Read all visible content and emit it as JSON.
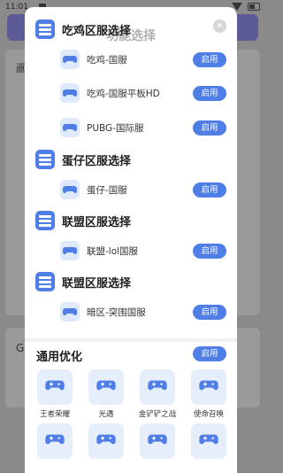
{
  "status_bar": {
    "time": "11:01"
  },
  "background": {
    "card1_peek": "画",
    "card2_peek": "G"
  },
  "dialog": {
    "title": "功能选择",
    "close_icon": "close-icon",
    "sections": [
      {
        "label": "吃鸡区服选择",
        "items": [
          {
            "label": "吃鸡-国服",
            "button": "启用"
          },
          {
            "label": "吃鸡-国服平板HD",
            "button": "启用"
          },
          {
            "label": "PUBG-国际服",
            "button": "启用"
          }
        ]
      },
      {
        "label": "蛋仔区服选择",
        "items": [
          {
            "label": "蛋仔-国服",
            "button": "启用"
          }
        ]
      },
      {
        "label": "联盟区服选择",
        "items": [
          {
            "label": "联盟-lol国服",
            "button": "启用"
          }
        ]
      },
      {
        "label": "联盟区服选择",
        "items": [
          {
            "label": "暗区-突围国服",
            "button": "启用"
          }
        ]
      }
    ],
    "optimize": {
      "title": "通用优化",
      "button": "启用",
      "games": [
        {
          "label": "王者荣耀"
        },
        {
          "label": "光遇"
        },
        {
          "label": "金铲铲之战"
        },
        {
          "label": "使命召唤"
        },
        {
          "label": ""
        },
        {
          "label": ""
        },
        {
          "label": ""
        },
        {
          "label": ""
        }
      ]
    }
  },
  "colors": {
    "accent": "#4f7fe6",
    "icon_bg": "#dfe9fc"
  }
}
